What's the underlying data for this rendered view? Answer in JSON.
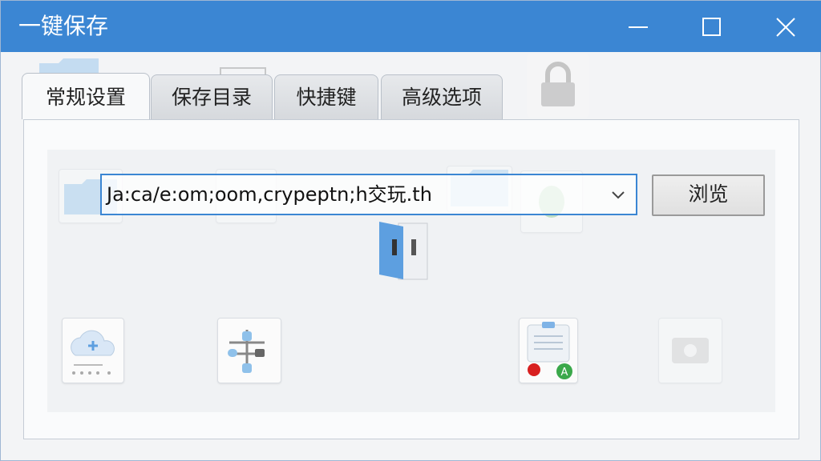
{
  "window": {
    "title": "一键保存",
    "controls": {
      "minimize_icon": "minimize-icon",
      "maximize_icon": "maximize-icon",
      "close_icon": "close-icon"
    }
  },
  "tabs": [
    {
      "label": "常规设置",
      "active": true
    },
    {
      "label": "保存目录",
      "active": false
    },
    {
      "label": "快捷键",
      "active": false
    },
    {
      "label": "高级选项",
      "active": false
    }
  ],
  "path_field": {
    "value": "Ja:ca/e:om;oom,crypeptn;h交玩.th",
    "dropdown_icon": "chevron-down-icon"
  },
  "browse_label": "浏览",
  "icons": {
    "lock": "lock-icon",
    "folder": "folder-icon",
    "cloud_upload": "cloud-upload-icon",
    "network": "network-diagram-icon",
    "record": "record-app-icon",
    "gear": "gear-icon",
    "book": "book-icon",
    "green_leaf": "leaf-icon"
  },
  "colors": {
    "titlebar": "#3b86d3",
    "accent": "#3b86d3"
  }
}
